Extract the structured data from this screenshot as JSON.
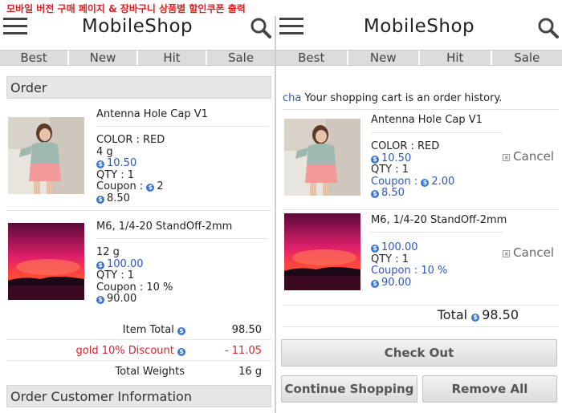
{
  "caption": "모바일 버전 구매 페이지 & 장바구니 상품별 할인쿠폰 출력",
  "header": {
    "logo": "MobileShop"
  },
  "tabs": [
    "Best",
    "New",
    "Hit",
    "Sale"
  ],
  "left": {
    "section_title": "Order",
    "items": [
      {
        "name": "Antenna Hole Cap V1",
        "details": [
          "COLOR : RED",
          "4 g"
        ],
        "price": "10.50",
        "qty": "QTY : 1",
        "coupon": "Coupon :",
        "coupon_value": "2",
        "final": "8.50"
      },
      {
        "name": "M6, 1/4-20 StandOff-2mm",
        "details": [
          "12 g"
        ],
        "price": "100.00",
        "qty": "QTY : 1",
        "coupon": "Coupon : 10 %",
        "final": "90.00"
      }
    ],
    "summary": {
      "item_total_label": "Item Total",
      "item_total_value": "98.50",
      "discount_label": "gold 10% Discount",
      "discount_value": "- 11.05",
      "weights_label": "Total Weights",
      "weights_value": "16 g"
    },
    "customer_section_title": "Order Customer Information"
  },
  "right": {
    "notice_user": "cha",
    "notice_text": "Your shopping cart is an order history.",
    "items": [
      {
        "name": "Antenna Hole Cap V1",
        "details": [
          "COLOR : RED"
        ],
        "price": "10.50",
        "qty": "QTY : 1",
        "coupon": "Coupon :",
        "coupon_value": "2.00",
        "final": "8.50",
        "cancel": "Cancel"
      },
      {
        "name": "M6, 1/4-20 StandOff-2mm",
        "details": [],
        "price": "100.00",
        "qty": "QTY : 1",
        "coupon": "Coupon : 10 %",
        "final": "90.00",
        "cancel": "Cancel"
      }
    ],
    "total_label": "Total",
    "total_value": "98.50",
    "checkout_label": "Check Out",
    "continue_label": "Continue Shopping",
    "remove_label": "Remove All"
  },
  "colors": {
    "accent_blue": "#2a56c6",
    "discount_red": "#e0202a",
    "tab_bar": "#dcdcdc"
  }
}
